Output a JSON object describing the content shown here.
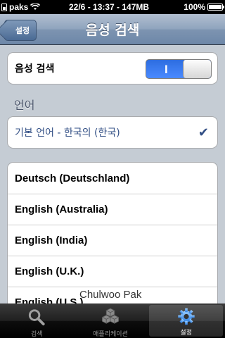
{
  "status_bar": {
    "carrier": "paks",
    "time": "22/6 - 13:37 - 147MB",
    "battery_percent": "100%",
    "battery_level": 1.0
  },
  "nav": {
    "back_label": "설정",
    "title": "음성 검색"
  },
  "voice_search": {
    "label": "음성 검색",
    "toggle_on_text": "I",
    "enabled": true
  },
  "language_section": {
    "header": "언어",
    "selected": "기본 언어 - 한국의 (한국)"
  },
  "languages": [
    "Deutsch (Deutschland)",
    "English (Australia)",
    "English (India)",
    "English (U.K.)",
    "English (U.S.)"
  ],
  "watermark": "Chulwoo Pak",
  "tab_bar": {
    "tabs": [
      {
        "label": "검색",
        "icon": "search-icon",
        "selected": false
      },
      {
        "label": "애플리케이션",
        "icon": "cubes-icon",
        "selected": false
      },
      {
        "label": "설정",
        "icon": "gear-icon",
        "selected": true
      }
    ]
  },
  "colors": {
    "accent_blue": "#324f85",
    "toggle_on": "#3a7cf5",
    "nav_bar": "#7d94b1"
  }
}
